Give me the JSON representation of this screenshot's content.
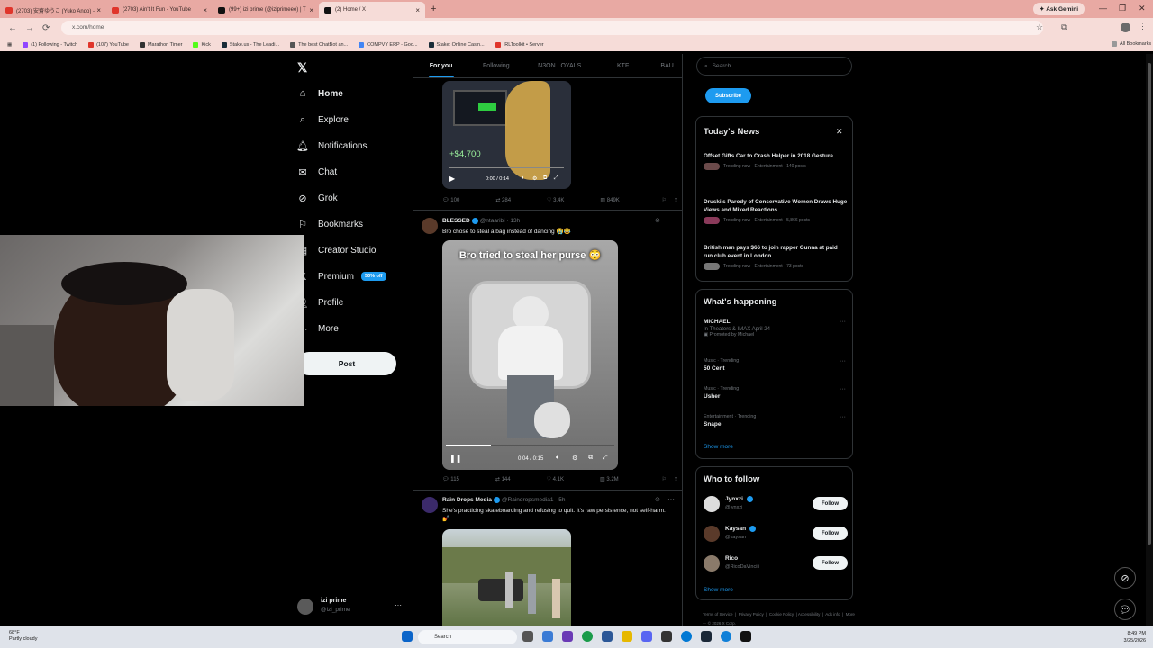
{
  "browser": {
    "tabs": [
      {
        "label": "(2703) 安齋ゆうこ (Yuko Ando) -",
        "favicon_color": "#e0352b"
      },
      {
        "label": "(2703) Ain't It Fun - YouTube",
        "favicon_color": "#e0352b"
      },
      {
        "label": "(99+) izi prime (@iziprimeee) | T",
        "favicon_color": "#111111"
      },
      {
        "label": "(2) Home / X",
        "favicon_color": "#111111"
      }
    ],
    "ask_gemini": "Ask Gemini",
    "url": "x.com/home",
    "bookmarks": [
      "(1) Following - Twitch",
      "(107) YouTube",
      "Marathon Timer",
      "Kick",
      "Stake.us - The Leadi...",
      "The best ChatBot an...",
      "COMPVY ERP - Goo...",
      "Stake: Online Casin...",
      "IRLToolkit • Server"
    ],
    "all_bookmarks": "All Bookmarks"
  },
  "sidebar": {
    "items": [
      {
        "label": "Home",
        "icon": "home-icon"
      },
      {
        "label": "Explore",
        "icon": "search-icon"
      },
      {
        "label": "Notifications",
        "icon": "bell-icon"
      },
      {
        "label": "Chat",
        "icon": "mail-icon"
      },
      {
        "label": "Grok",
        "icon": "grok-icon"
      },
      {
        "label": "Bookmarks",
        "icon": "bookmark-icon"
      },
      {
        "label": "Creator Studio",
        "icon": "creator-icon"
      },
      {
        "label": "Premium",
        "icon": "x-icon"
      },
      {
        "label": "Profile",
        "icon": "person-icon"
      },
      {
        "label": "More",
        "icon": "more-icon"
      }
    ],
    "premium_badge": "50% off",
    "post_label": "Post",
    "profile": {
      "name": "izi prime",
      "handle": "@izi_prime"
    }
  },
  "feed": {
    "tabs": [
      "For you",
      "Following",
      "N3ON LOYALS",
      "KTF",
      "BAU"
    ],
    "tweet1": {
      "overlay_value": "+$4,700",
      "time": "0:00 / 0:14",
      "stats": [
        "100",
        "284",
        "3.4K",
        "849K"
      ]
    },
    "tweet2": {
      "name": "BLESSED",
      "handle": "@ntaaribi",
      "age": "· 13h",
      "text": "Bro chose to steal a bag instead of dancing 😭😂",
      "caption": "Bro tried to steal her purse 😳",
      "time": "0:04 / 0:15",
      "progress": 0.27,
      "stats": [
        "115",
        "144",
        "4.1K",
        "3.2M"
      ]
    },
    "tweet3": {
      "name": "Rain Drops Media",
      "handle": "@Raindropsmedia1",
      "age": "· 5h",
      "text": "She's practicing skateboarding and refusing to quit. It's raw persistence, not self-harm. 💅"
    }
  },
  "right": {
    "search_placeholder": "Search",
    "subscribe_label": "Subscribe",
    "news_title": "Today's News",
    "news": [
      {
        "title": "Offset Gifts Car to Crash Helper in 2018 Gesture",
        "meta": "Trending now · Entertainment · 140 posts"
      },
      {
        "title": "Druski's Parody of Conservative Women Draws Huge Views and Mixed Reactions",
        "meta": "Trending now · Entertainment · 5,866 posts"
      },
      {
        "title": "British man pays $66 to join rapper Gunna at paid run club event in London",
        "meta": "Trending now · Entertainment · 73 posts"
      }
    ],
    "happening_title": "What's happening",
    "trends": [
      {
        "name": "MICHAEL",
        "sub": "In Theaters & IMAX April 24",
        "promo": "Promoted by Michael"
      },
      {
        "category": "Music · Trending",
        "name": "50 Cent"
      },
      {
        "category": "Music · Trending",
        "name": "Usher"
      },
      {
        "category": "Entertainment · Trending",
        "name": "Snape"
      }
    ],
    "show_more": "Show more",
    "wtf_title": "Who to follow",
    "follow": [
      {
        "name": "Jynxzi",
        "handle": "@jynxzi"
      },
      {
        "name": "Kaysan",
        "handle": "@kaysan"
      },
      {
        "name": "Rico",
        "handle": "@RicoDaVinciii"
      }
    ],
    "follow_label": "Follow",
    "footer": [
      "Terms of Service",
      "Privacy Policy",
      "Cookie Policy",
      "Accessibility",
      "Ads info",
      "More ···",
      "© 2026 X Corp."
    ]
  },
  "taskbar": {
    "temp": "68°F",
    "weather": "Partly cloudy",
    "search": "Search",
    "time": "8:49 PM",
    "date": "3/25/2026"
  }
}
